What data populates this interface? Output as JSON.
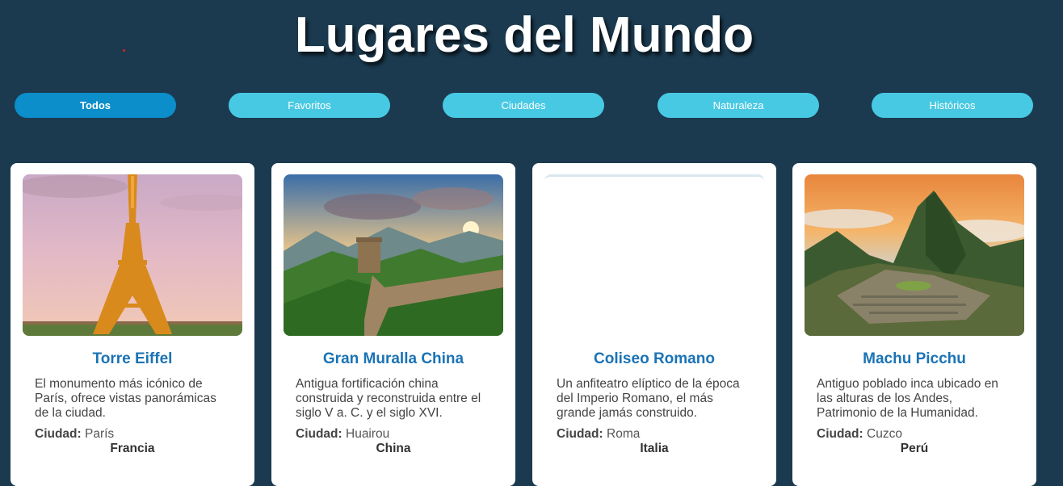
{
  "header": {
    "title": "Lugares del Mundo"
  },
  "filters": [
    {
      "label": "Todos",
      "active": true
    },
    {
      "label": "Favoritos"
    },
    {
      "label": "Ciudades"
    },
    {
      "label": "Naturaleza"
    },
    {
      "label": "Históricos"
    }
  ],
  "city_label": "Ciudad:",
  "cards": [
    {
      "name": "Torre Eiffel",
      "description": "El monumento más icónico de París, ofrece vistas panorámicas de la ciudad.",
      "city": "París",
      "country": "Francia"
    },
    {
      "name": "Gran Muralla China",
      "description": "Antigua fortificación china construida y reconstruida entre el siglo V a. C. y el siglo XVI.",
      "city": "Huairou",
      "country": "China"
    },
    {
      "name": "Coliseo Romano",
      "description": "Un anfiteatro elíptico de la época del Imperio Romano, el más grande jamás construido.",
      "city": "Roma",
      "country": "Italia"
    },
    {
      "name": "Machu Picchu",
      "description": "Antiguo poblado inca ubicado en las alturas de los Andes, Patrimonio de la Humanidad.",
      "city": "Cuzco",
      "country": "Perú"
    }
  ]
}
